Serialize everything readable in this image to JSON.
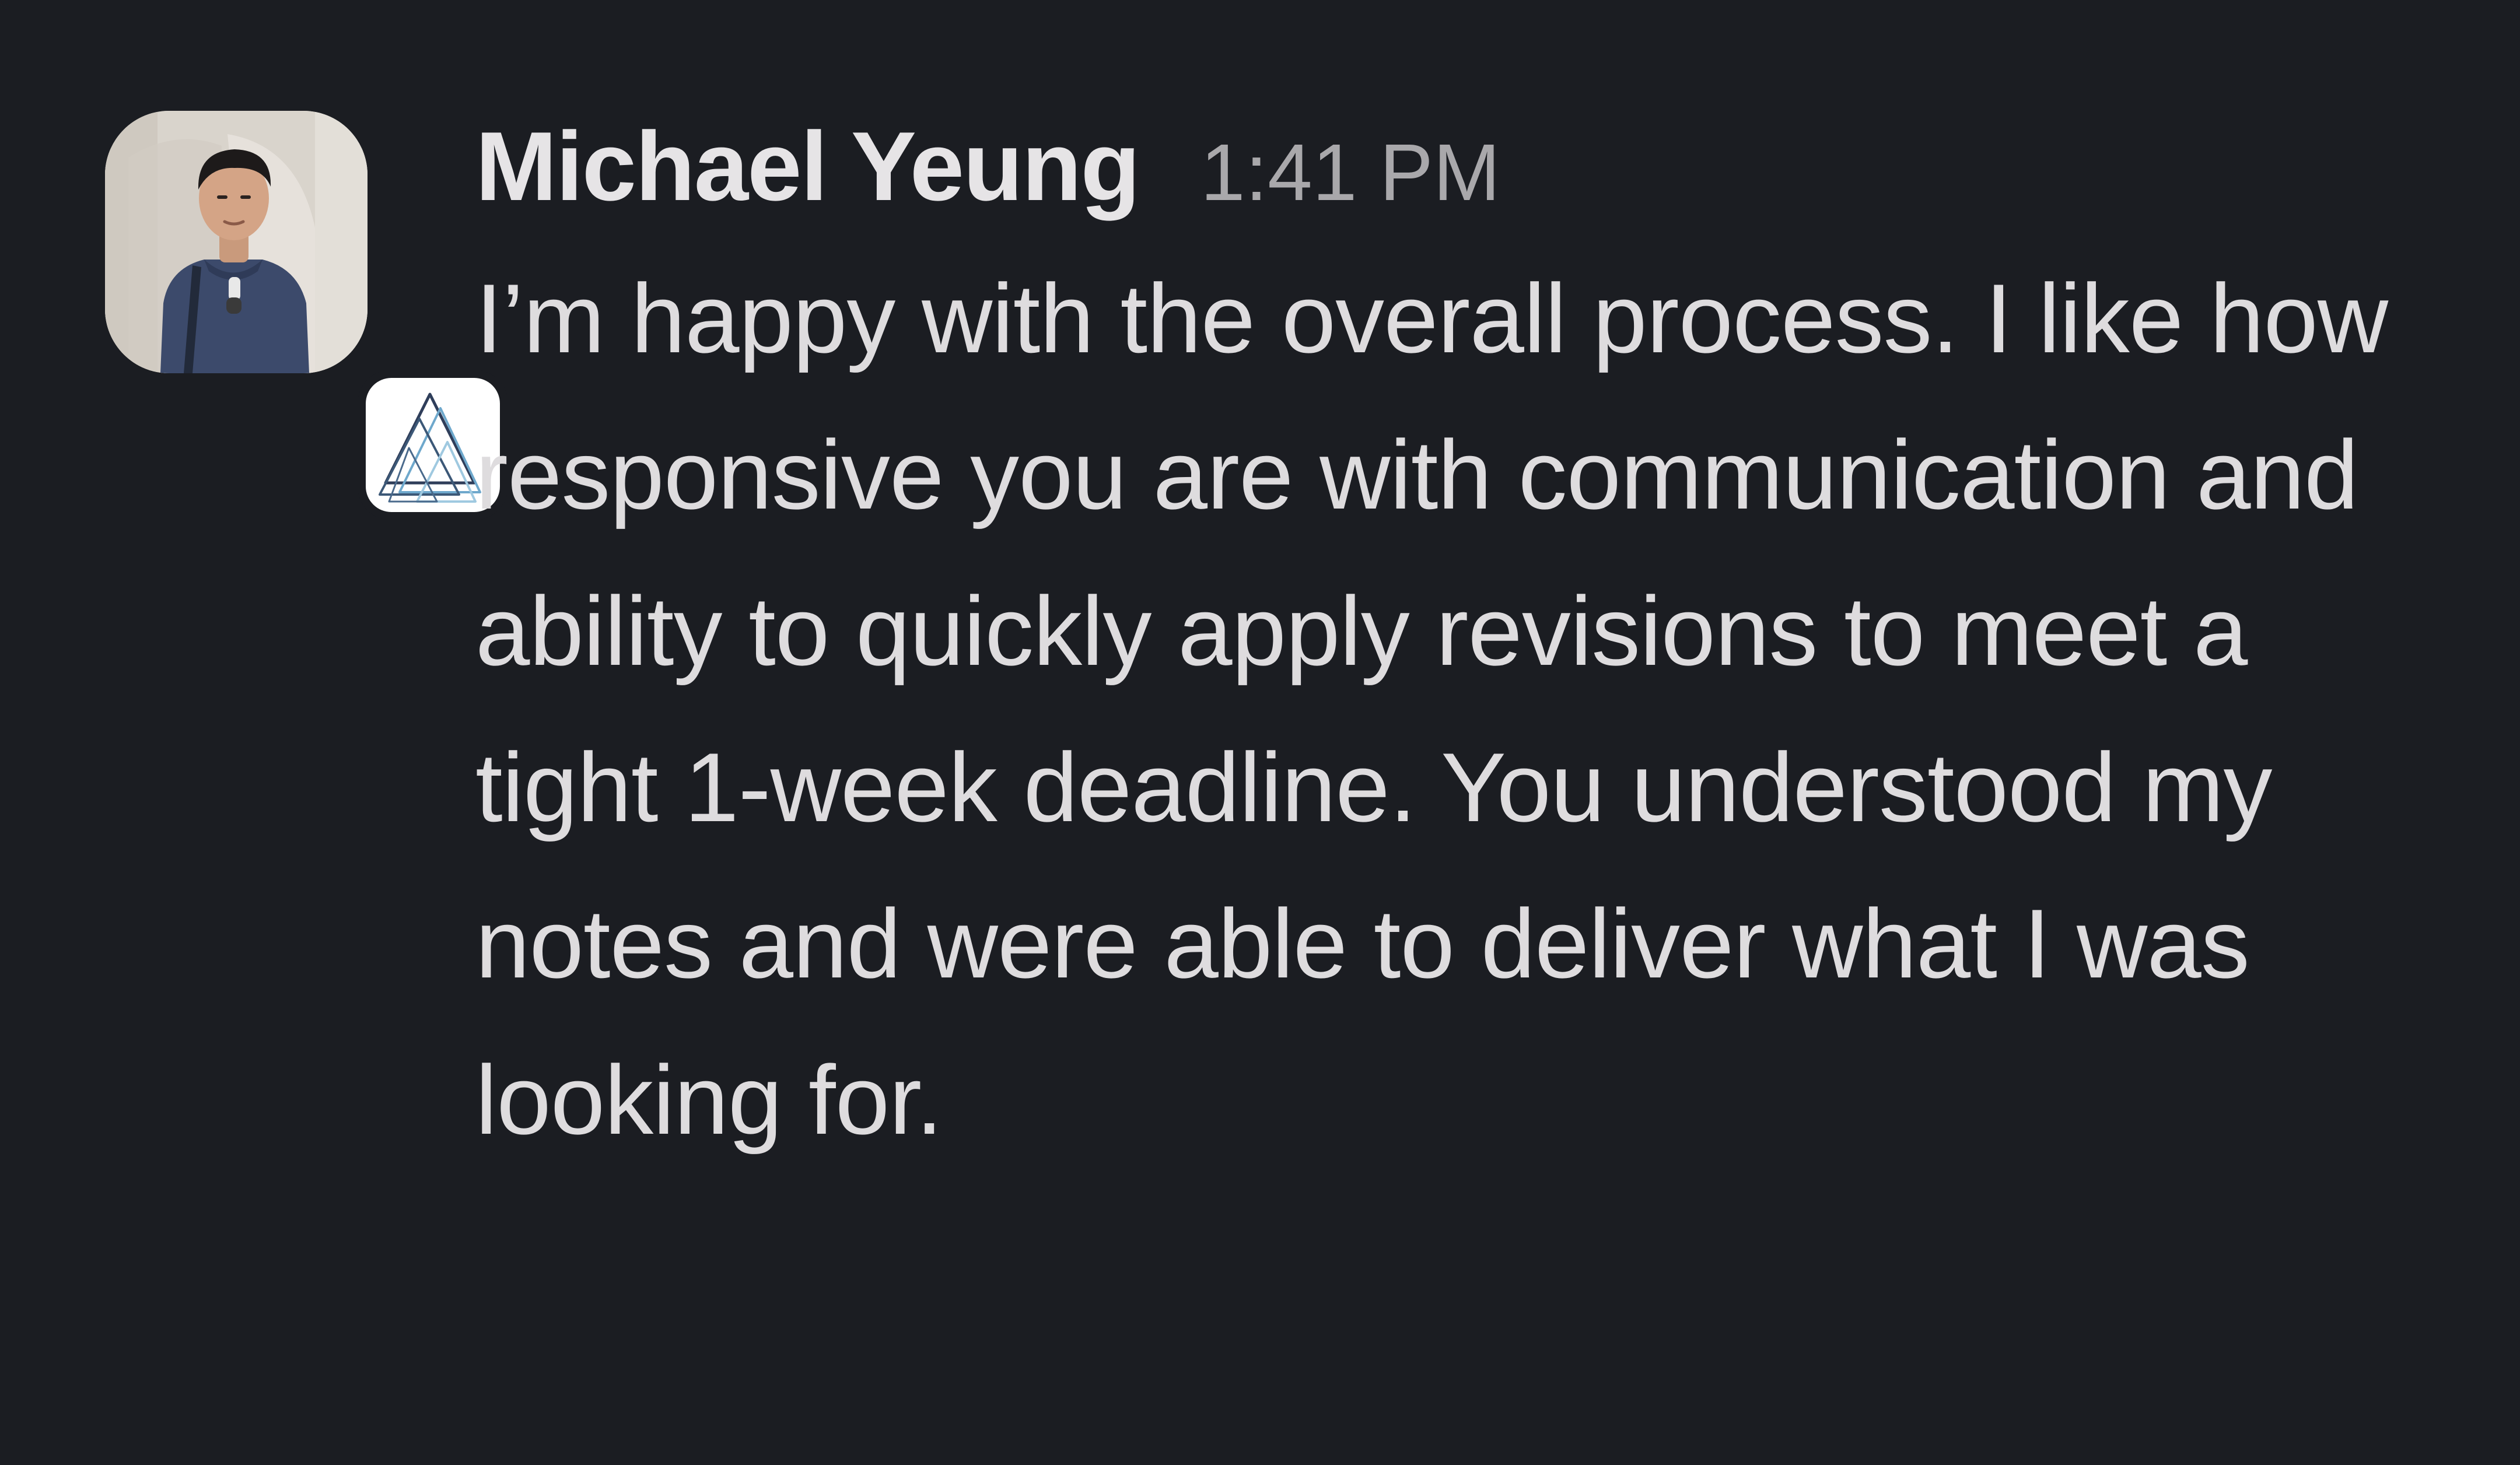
{
  "message": {
    "sender": "Michael Yeung",
    "time": "1:41 PM",
    "text": "I’m happy with the overall process. I like how responsive you are with communication and ability to quickly apply revisions to meet a tight 1-week deadline. You understood my notes and were able to deliver what I was looking for.",
    "avatar_icon": "user-avatar-photo",
    "badge_icon": "triangles-logo-icon"
  },
  "colors": {
    "background": "#1b1d22",
    "name": "#e6e4e6",
    "timestamp": "#a9a8ab",
    "text": "#dedcde",
    "badge_background": "#ffffff"
  }
}
